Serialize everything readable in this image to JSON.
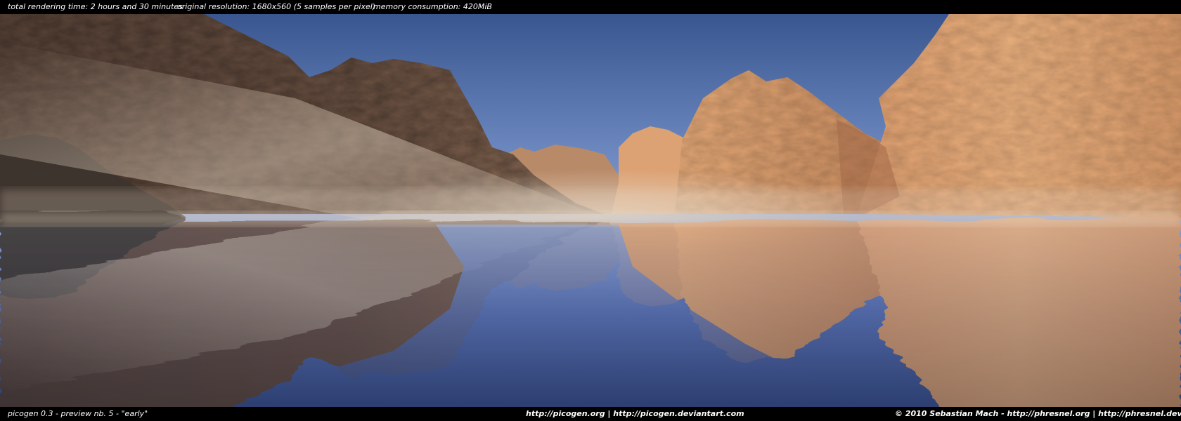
{
  "header": {
    "render_time": "total rendering time: 2 hours and 30 minutes",
    "resolution": "original resolution: 1680x560 (5 samples per pixel)",
    "memory": "memory consumption: 420MiB"
  },
  "footer": {
    "title": "picogen 0.3 - preview nb. 5 - \"early\"",
    "links": "http://picogen.org | http://picogen.deviantart.com",
    "copyright": "© 2010 Sebastian Mach - http://phresnel.org | http://phresnel.deviantart.com"
  },
  "scene": {
    "sky_top": "#3d5a92",
    "sky_bottom": "#7f9cd6",
    "rock_lit": "#f0b480",
    "rock_shadow": "#5a4438",
    "water": "#5a74b8",
    "fog": "#d8c6b0"
  }
}
